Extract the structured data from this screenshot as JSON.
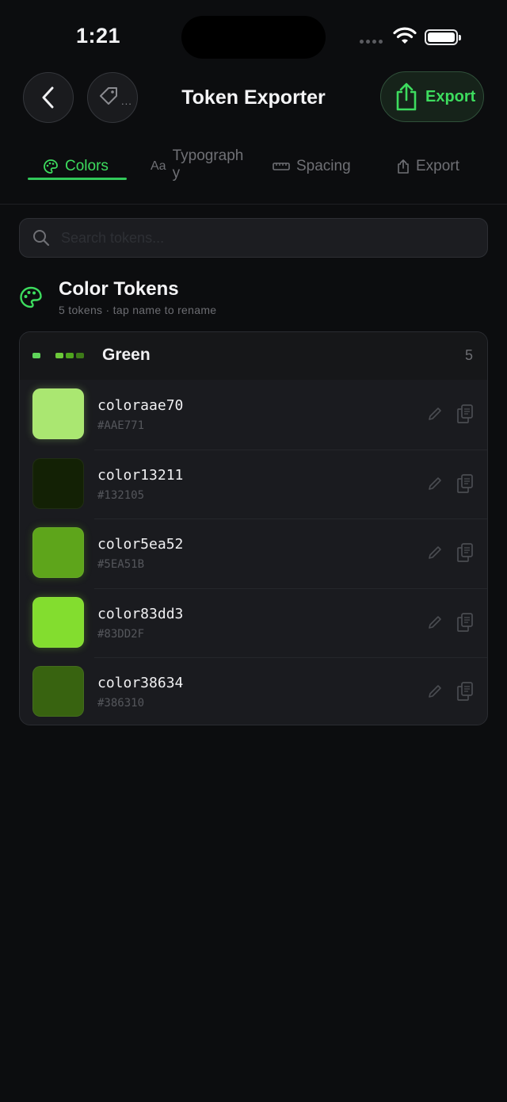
{
  "status_bar": {
    "time": "1:21"
  },
  "header": {
    "title": "Token Exporter",
    "export_label": "Export",
    "tag_more": "..."
  },
  "tabs": [
    {
      "label": "Colors",
      "icon": "palette-icon",
      "active": true
    },
    {
      "label": "Typography",
      "icon": "aa-icon",
      "icon_text": "Aa",
      "active": false
    },
    {
      "label": "Spacing",
      "icon": "ruler-icon",
      "active": false
    },
    {
      "label": "Export",
      "icon": "share-icon",
      "active": false
    }
  ],
  "search": {
    "placeholder": "Search tokens...",
    "value": ""
  },
  "section": {
    "title": "Color Tokens",
    "subtitle": "5 tokens · tap name to rename"
  },
  "group": {
    "name": "Green",
    "count": "5",
    "tokens": [
      {
        "name": "coloraae70",
        "hex": "#AAE771"
      },
      {
        "name": "color13211",
        "hex": "#132105"
      },
      {
        "name": "color5ea52",
        "hex": "#5EA51B"
      },
      {
        "name": "color83dd3",
        "hex": "#83DD2F"
      },
      {
        "name": "color38634",
        "hex": "#386310"
      }
    ]
  },
  "colors": {
    "accent": "#3DDC5E",
    "background": "#0C0D0F",
    "card": "#1A1B1F"
  }
}
